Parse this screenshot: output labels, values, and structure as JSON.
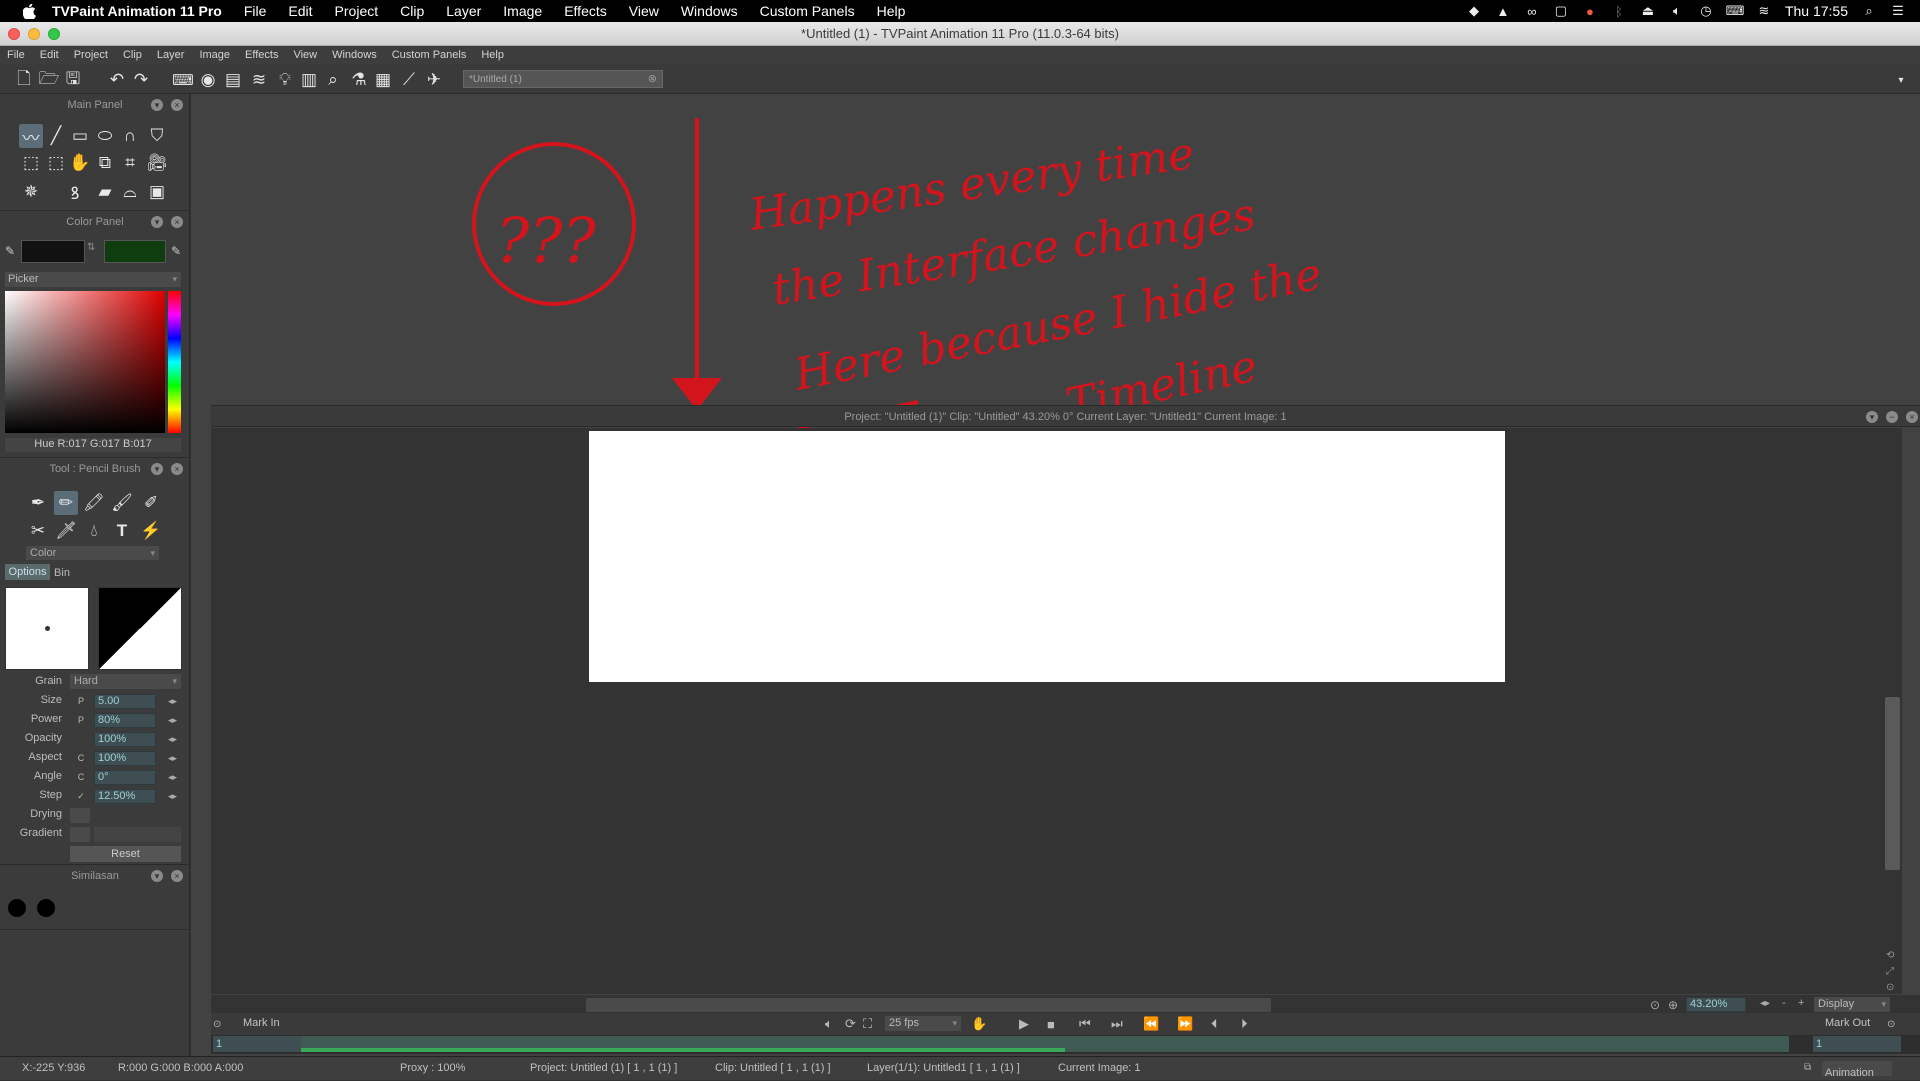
{
  "menubar": {
    "app_name": "TVPaint Animation 11 Pro",
    "items": [
      "File",
      "Edit",
      "Project",
      "Clip",
      "Layer",
      "Image",
      "Effects",
      "View",
      "Windows",
      "Custom Panels",
      "Help"
    ],
    "clock": "Thu 17:55"
  },
  "window": {
    "title": "*Untitled (1) - TVPaint Animation 11 Pro (11.0.3-64 bits)"
  },
  "app_menu": {
    "items": [
      "File",
      "Edit",
      "Project",
      "Clip",
      "Layer",
      "Image",
      "Effects",
      "View",
      "Windows",
      "Custom Panels",
      "Help"
    ]
  },
  "doc_tab": {
    "label": "*Untitled (1)"
  },
  "main_panel": {
    "title": "Main Panel"
  },
  "color_panel": {
    "title": "Color Panel",
    "mode": "Picker",
    "info": "Hue R:017 G:017 B:017",
    "primary_color": "#111111",
    "secondary_color": "#0f3d10"
  },
  "tool_panel": {
    "title": "Tool : Pencil Brush",
    "mode": "Color",
    "tabs": [
      "Options",
      "Bin"
    ],
    "grain_label": "Grain",
    "grain_value": "Hard",
    "size_label": "Size",
    "size_value": "5.00",
    "power_label": "Power",
    "power_value": "80%",
    "opacity_label": "Opacity",
    "opacity_value": "100%",
    "aspect_label": "Aspect",
    "aspect_value": "100%",
    "angle_label": "Angle",
    "angle_value": "0°",
    "step_label": "Step",
    "step_value": "12.50%",
    "drying_label": "Drying",
    "gradient_label": "Gradient",
    "reset_label": "Reset"
  },
  "similasan_panel": {
    "title": "Similasan"
  },
  "view": {
    "info": "Project: \"Untitled (1)\"  Clip: \"Untitled\"  43.20%  0°  Current Layer: \"Untitled1\"  Current Image: 1",
    "zoom": "43.20%",
    "display_label": "Display"
  },
  "annotation": {
    "circle_text": "???",
    "line1": "Happens every time",
    "line2": "the Interface changes",
    "line3": "Here  because I hide the",
    "line4": "Timeline",
    "color": "#d4141c"
  },
  "playback": {
    "mark_in": "Mark In",
    "mark_out": "Mark Out",
    "fps": "25 fps",
    "frame_start": "1",
    "frame_end": "1"
  },
  "statusbar": {
    "coords": "X:-225  Y:936",
    "rgba": "R:000 G:000 B:000 A:000",
    "proxy": "Proxy : 100%",
    "project": "Project: Untitled (1) [ 1 , 1  (1) ]",
    "clip": "Clip: Untitled [ 1 , 1  (1) ]",
    "layer": "Layer(1/1): Untitled1 [ 1 , 1  (1) ]",
    "current_image": "Current Image: 1",
    "mode": "Animation"
  }
}
